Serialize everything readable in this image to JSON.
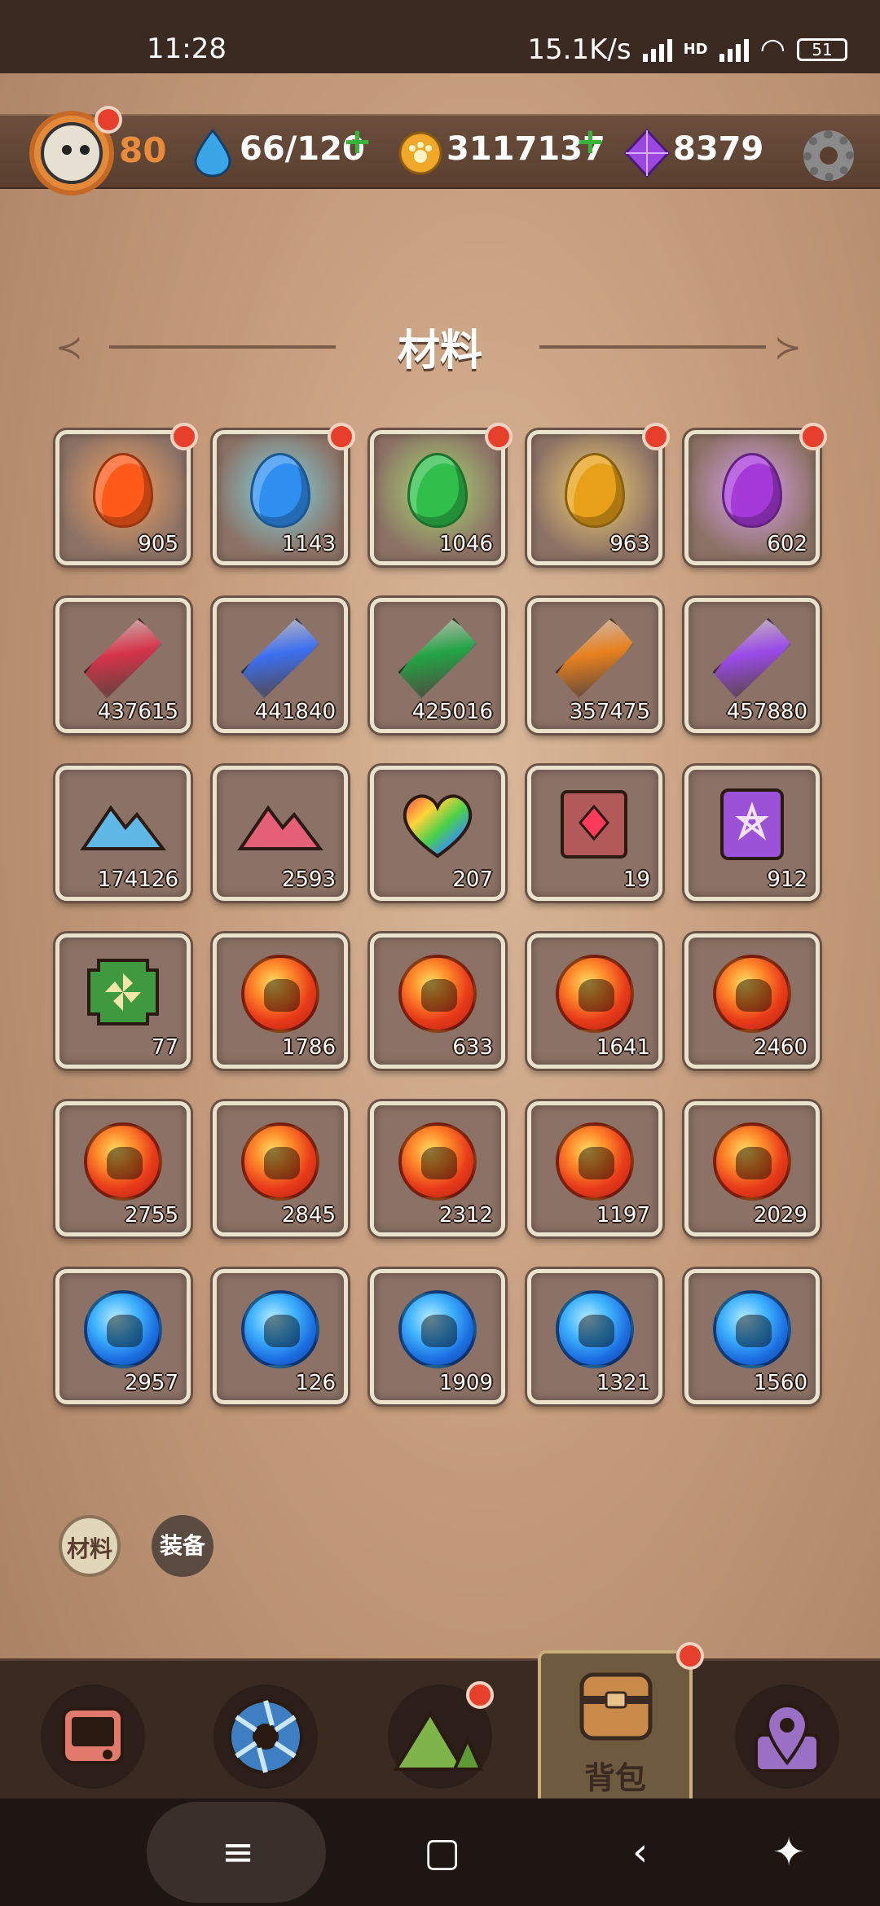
{
  "status_bar": {
    "time": "11:28",
    "net_speed": "15.1K/s",
    "network_tag": "HD",
    "battery": "51"
  },
  "header": {
    "level": "80",
    "energy": "66/120",
    "coins": "3117137",
    "gems": "8379",
    "plus": "+"
  },
  "title": "材料",
  "items": [
    {
      "count": "905",
      "kind": "egg",
      "color": "#ff5a1a",
      "glow": "#f0a060",
      "badge": true
    },
    {
      "count": "1143",
      "kind": "egg",
      "color": "#2f8ff0",
      "glow": "#7fd2e0",
      "badge": true
    },
    {
      "count": "1046",
      "kind": "egg",
      "color": "#2fbf4a",
      "glow": "#a7d870",
      "badge": true
    },
    {
      "count": "963",
      "kind": "egg",
      "color": "#e7a018",
      "glow": "#f0cc70",
      "badge": true
    },
    {
      "count": "602",
      "kind": "egg",
      "color": "#a63ad8",
      "glow": "#d9a0e8",
      "badge": true
    },
    {
      "count": "437615",
      "kind": "crystal",
      "color": "#d6334a"
    },
    {
      "count": "441840",
      "kind": "crystal",
      "color": "#3c6ff0"
    },
    {
      "count": "425016",
      "kind": "crystal",
      "color": "#23a346"
    },
    {
      "count": "357475",
      "kind": "crystal",
      "color": "#e8801f"
    },
    {
      "count": "457880",
      "kind": "crystal",
      "color": "#9a4ae8"
    },
    {
      "count": "174126",
      "kind": "rock",
      "color": "#5fb8e6"
    },
    {
      "count": "2593",
      "kind": "rock",
      "color": "#e46077"
    },
    {
      "count": "207",
      "kind": "heart",
      "color": "#ff6a6a"
    },
    {
      "count": "19",
      "kind": "book",
      "color": "#b25a5a"
    },
    {
      "count": "912",
      "kind": "card",
      "color": "#9b52d6"
    },
    {
      "count": "77",
      "kind": "plate",
      "color": "#3f9a3f"
    },
    {
      "count": "1786",
      "kind": "orb-red"
    },
    {
      "count": "633",
      "kind": "orb-red"
    },
    {
      "count": "1641",
      "kind": "orb-red"
    },
    {
      "count": "2460",
      "kind": "orb-red"
    },
    {
      "count": "2755",
      "kind": "orb-red"
    },
    {
      "count": "2845",
      "kind": "orb-red"
    },
    {
      "count": "2312",
      "kind": "orb-red"
    },
    {
      "count": "1197",
      "kind": "orb-red"
    },
    {
      "count": "2029",
      "kind": "orb-red"
    },
    {
      "count": "2957",
      "kind": "orb-blue"
    },
    {
      "count": "126",
      "kind": "orb-blue"
    },
    {
      "count": "1909",
      "kind": "orb-blue"
    },
    {
      "count": "1321",
      "kind": "orb-blue"
    },
    {
      "count": "1560",
      "kind": "orb-blue"
    }
  ],
  "tabs": {
    "materials": "材料",
    "equipment": "装备"
  },
  "bottom_nav": {
    "bag_label": "背包"
  }
}
